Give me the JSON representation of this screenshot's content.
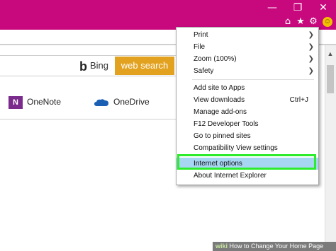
{
  "colors": {
    "titlebar": "#c8097d",
    "web_search_button": "#e2a21f",
    "highlight_outline": "#2cec2c",
    "selected_item_bg": "#a7d6f3"
  },
  "titlebar": {
    "window_controls": [
      "minimize-icon",
      "restore-icon",
      "close-icon"
    ],
    "toolbar_icons": [
      "home-icon",
      "star-icon",
      "gear-icon",
      "smiley-icon"
    ]
  },
  "search": {
    "provider_label": "Bing",
    "button_label": "web search"
  },
  "favorites": {
    "onenote_label": "OneNote",
    "onenote_icon_letter": "N",
    "onedrive_label": "OneDrive"
  },
  "menu": {
    "group1": [
      {
        "label": "Print",
        "submenu": true
      },
      {
        "label": "File",
        "submenu": true
      },
      {
        "label": "Zoom (100%)",
        "submenu": true
      },
      {
        "label": "Safety",
        "submenu": true
      }
    ],
    "group2": [
      {
        "label": "Add site to Apps",
        "accel": ""
      },
      {
        "label": "View downloads",
        "accel": "Ctrl+J"
      },
      {
        "label": "Manage add-ons",
        "accel": ""
      },
      {
        "label": "F12 Developer Tools",
        "accel": ""
      },
      {
        "label": "Go to pinned sites",
        "accel": ""
      },
      {
        "label": "Compatibility View settings",
        "accel": ""
      }
    ],
    "group3": [
      {
        "label": "Internet options",
        "highlighted": true
      },
      {
        "label": "About Internet Explorer"
      }
    ]
  },
  "watermark": {
    "brand": "wiki",
    "text": "How to Change Your Home Page"
  }
}
